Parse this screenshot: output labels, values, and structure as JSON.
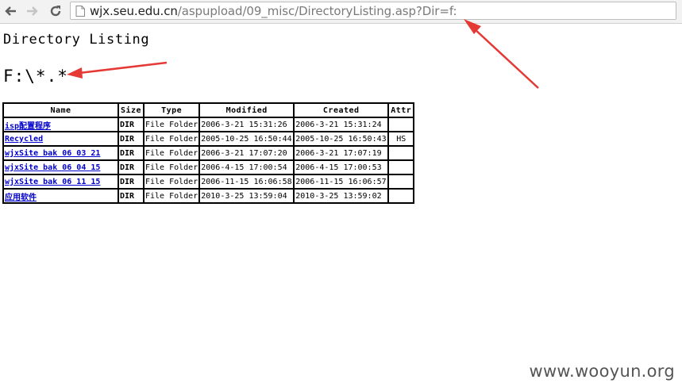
{
  "browser": {
    "url_host": "wjx.seu.edu.cn",
    "url_path": "/aspupload/09_misc/DirectoryListing.asp?Dir=f:"
  },
  "page": {
    "title": "Directory Listing",
    "path": "F:\\*.*"
  },
  "table": {
    "headers": [
      "Name",
      "Size",
      "Type",
      "Modified",
      "Created",
      "Attr"
    ],
    "rows": [
      {
        "name": "isp配置程序",
        "size": "DIR",
        "type": "File Folder",
        "modified": "2006-3-21 15:31:26",
        "created": "2006-3-21 15:31:24",
        "attr": ""
      },
      {
        "name": "Recycled",
        "size": "DIR",
        "type": "File Folder",
        "modified": "2005-10-25 16:50:44",
        "created": "2005-10-25 16:50:43",
        "attr": "HS"
      },
      {
        "name": "wjxSite bak 06 03 21",
        "size": "DIR",
        "type": "File Folder",
        "modified": "2006-3-21 17:07:20",
        "created": "2006-3-21 17:07:19",
        "attr": ""
      },
      {
        "name": "wjxSite bak 06 04 15",
        "size": "DIR",
        "type": "File Folder",
        "modified": "2006-4-15 17:00:54",
        "created": "2006-4-15 17:00:53",
        "attr": ""
      },
      {
        "name": "wjxSite bak 06 11 15",
        "size": "DIR",
        "type": "File Folder",
        "modified": "2006-11-15 16:06:58",
        "created": "2006-11-15 16:06:57",
        "attr": ""
      },
      {
        "name": "应用软件",
        "size": "DIR",
        "type": "File Folder",
        "modified": "2010-3-25 13:59:04",
        "created": "2010-3-25 13:59:02",
        "attr": ""
      }
    ]
  },
  "watermark": "www.wooyun.org",
  "colors": {
    "arrow": "#e53935",
    "link": "#0000cc"
  },
  "icons": [
    "back-arrow-icon",
    "forward-arrow-icon",
    "reload-icon",
    "page-icon"
  ]
}
